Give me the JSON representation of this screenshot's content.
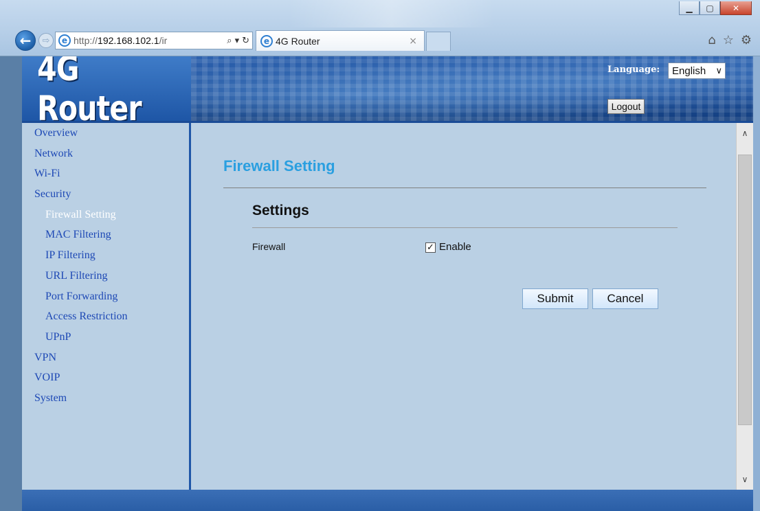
{
  "browser": {
    "url_prefix": "http://",
    "url_host": "192.168.102.1",
    "url_path": "/ir",
    "tab_title": "4G Router",
    "tab_close": "×",
    "back_symbol": "←",
    "forward_symbol": "⇨",
    "search_symbol": "⌕",
    "dropdown_symbol": "▾",
    "refresh_symbol": "↻",
    "home_symbol": "⌂",
    "favorites_symbol": "☆",
    "settings_symbol": "⚙",
    "minimize_symbol": "▁",
    "maximize_symbol": "▢",
    "close_symbol": "✕"
  },
  "header": {
    "logo": "4G Router",
    "language_label": "Language:",
    "language_value": "English",
    "language_caret": "∨",
    "logout_label": "Logout"
  },
  "sidebar": {
    "items": [
      {
        "label": "Overview"
      },
      {
        "label": "Network"
      },
      {
        "label": "Wi-Fi"
      },
      {
        "label": "Security"
      },
      {
        "label": "Firewall Setting"
      },
      {
        "label": "MAC Filtering"
      },
      {
        "label": "IP Filtering"
      },
      {
        "label": "URL Filtering"
      },
      {
        "label": "Port Forwarding"
      },
      {
        "label": "Access Restriction"
      },
      {
        "label": "UPnP"
      },
      {
        "label": "VPN"
      },
      {
        "label": "VOIP"
      },
      {
        "label": "System"
      }
    ]
  },
  "main": {
    "page_title": "Firewall Setting",
    "section_title": "Settings",
    "firewall_label": "Firewall",
    "firewall_checked_mark": "✓",
    "firewall_enable_label": "Enable",
    "submit_label": "Submit",
    "cancel_label": "Cancel"
  },
  "scrollbar": {
    "up_symbol": "∧",
    "down_symbol": "∨"
  },
  "colors": {
    "accent_title": "#2a9fe0",
    "nav_link": "#1d48b5",
    "nav_active": "#ffffff",
    "header_blue": "#1a4b96"
  }
}
